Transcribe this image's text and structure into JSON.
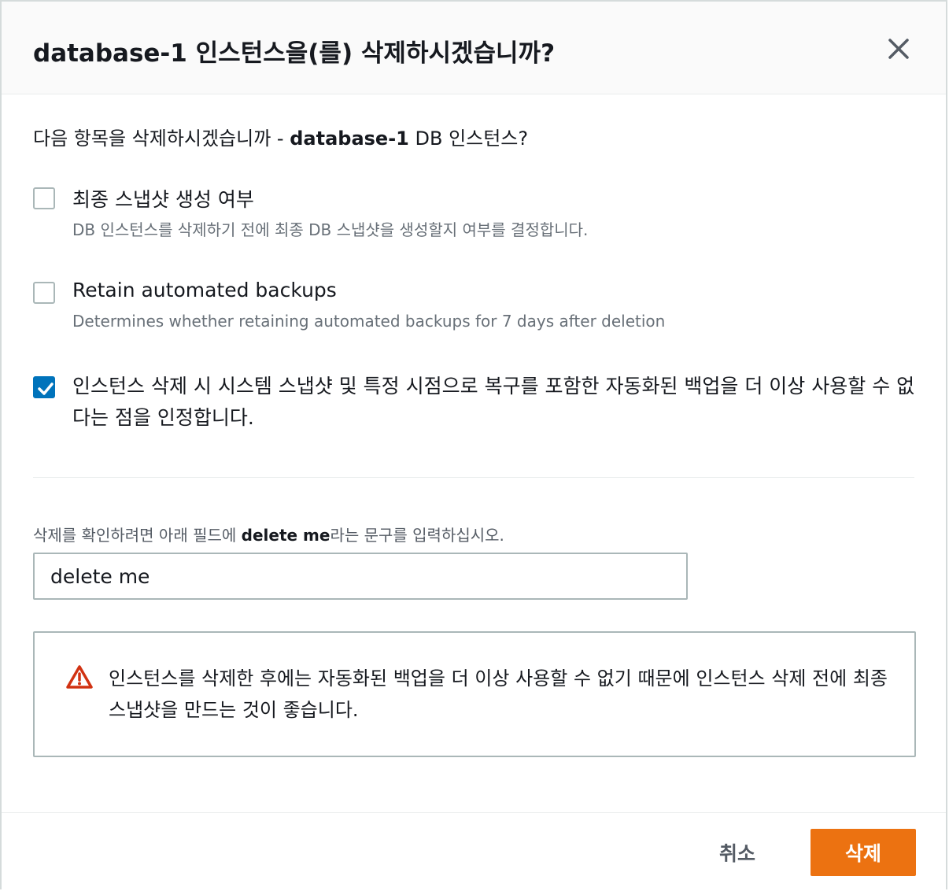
{
  "dialog": {
    "title": "database-1 인스턴스을(를) 삭제하시겠습니까?",
    "close_icon": "close-icon"
  },
  "lead": {
    "prefix": "다음 항목을 삭제하시겠습니까 - ",
    "instance_name": "database-1",
    "suffix": " DB 인스턴스?"
  },
  "options": [
    {
      "label": "최종 스냅샷 생성 여부",
      "description": "DB 인스턴스를 삭제하기 전에 최종 DB 스냅샷을 생성할지 여부를 결정합니다.",
      "checked": false
    },
    {
      "label": "Retain automated backups",
      "description": "Determines whether retaining automated backups for 7 days after deletion",
      "checked": false
    },
    {
      "label": "인스턴스 삭제 시 시스템 스냅샷 및 특정 시점으로 복구를 포함한 자동화된 백업을 더 이상 사용할 수 없다는 점을 인정합니다.",
      "checked": true
    }
  ],
  "confirm": {
    "label_prefix": "삭제를 확인하려면 아래 필드에 ",
    "label_phrase": "delete me",
    "label_suffix": "라는 문구를 입력하십시오.",
    "input_value": "delete me"
  },
  "alert": {
    "icon": "warning-icon",
    "text": "인스턴스를 삭제한 후에는 자동화된 백업을 더 이상 사용할 수 없기 때문에 인스턴스 삭제 전에 최종 스냅샷을 만드는 것이 좋습니다."
  },
  "footer": {
    "cancel_label": "취소",
    "delete_label": "삭제"
  },
  "colors": {
    "primary_button": "#ec7211",
    "checkbox_checked": "#0073bb",
    "warning": "#d13212"
  }
}
